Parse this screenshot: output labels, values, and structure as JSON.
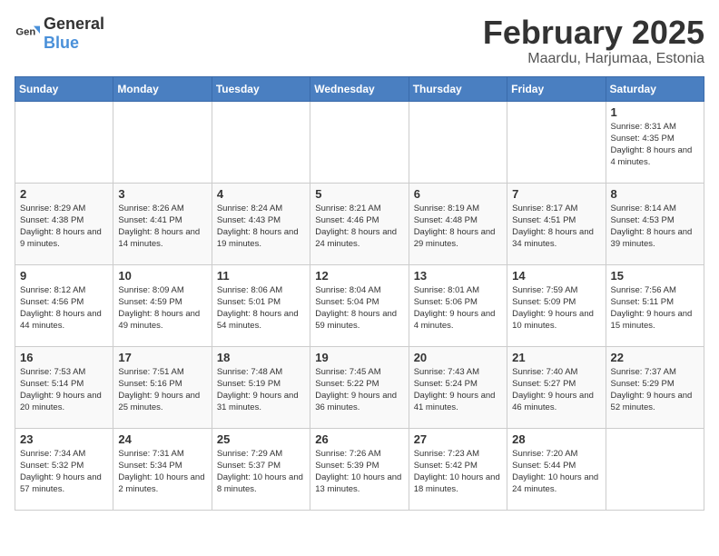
{
  "header": {
    "logo_general": "General",
    "logo_blue": "Blue",
    "main_title": "February 2025",
    "subtitle": "Maardu, Harjumaa, Estonia"
  },
  "days_of_week": [
    "Sunday",
    "Monday",
    "Tuesday",
    "Wednesday",
    "Thursday",
    "Friday",
    "Saturday"
  ],
  "weeks": [
    [
      {
        "day": "",
        "info": ""
      },
      {
        "day": "",
        "info": ""
      },
      {
        "day": "",
        "info": ""
      },
      {
        "day": "",
        "info": ""
      },
      {
        "day": "",
        "info": ""
      },
      {
        "day": "",
        "info": ""
      },
      {
        "day": "1",
        "info": "Sunrise: 8:31 AM\nSunset: 4:35 PM\nDaylight: 8 hours and 4 minutes."
      }
    ],
    [
      {
        "day": "2",
        "info": "Sunrise: 8:29 AM\nSunset: 4:38 PM\nDaylight: 8 hours and 9 minutes."
      },
      {
        "day": "3",
        "info": "Sunrise: 8:26 AM\nSunset: 4:41 PM\nDaylight: 8 hours and 14 minutes."
      },
      {
        "day": "4",
        "info": "Sunrise: 8:24 AM\nSunset: 4:43 PM\nDaylight: 8 hours and 19 minutes."
      },
      {
        "day": "5",
        "info": "Sunrise: 8:21 AM\nSunset: 4:46 PM\nDaylight: 8 hours and 24 minutes."
      },
      {
        "day": "6",
        "info": "Sunrise: 8:19 AM\nSunset: 4:48 PM\nDaylight: 8 hours and 29 minutes."
      },
      {
        "day": "7",
        "info": "Sunrise: 8:17 AM\nSunset: 4:51 PM\nDaylight: 8 hours and 34 minutes."
      },
      {
        "day": "8",
        "info": "Sunrise: 8:14 AM\nSunset: 4:53 PM\nDaylight: 8 hours and 39 minutes."
      }
    ],
    [
      {
        "day": "9",
        "info": "Sunrise: 8:12 AM\nSunset: 4:56 PM\nDaylight: 8 hours and 44 minutes."
      },
      {
        "day": "10",
        "info": "Sunrise: 8:09 AM\nSunset: 4:59 PM\nDaylight: 8 hours and 49 minutes."
      },
      {
        "day": "11",
        "info": "Sunrise: 8:06 AM\nSunset: 5:01 PM\nDaylight: 8 hours and 54 minutes."
      },
      {
        "day": "12",
        "info": "Sunrise: 8:04 AM\nSunset: 5:04 PM\nDaylight: 8 hours and 59 minutes."
      },
      {
        "day": "13",
        "info": "Sunrise: 8:01 AM\nSunset: 5:06 PM\nDaylight: 9 hours and 4 minutes."
      },
      {
        "day": "14",
        "info": "Sunrise: 7:59 AM\nSunset: 5:09 PM\nDaylight: 9 hours and 10 minutes."
      },
      {
        "day": "15",
        "info": "Sunrise: 7:56 AM\nSunset: 5:11 PM\nDaylight: 9 hours and 15 minutes."
      }
    ],
    [
      {
        "day": "16",
        "info": "Sunrise: 7:53 AM\nSunset: 5:14 PM\nDaylight: 9 hours and 20 minutes."
      },
      {
        "day": "17",
        "info": "Sunrise: 7:51 AM\nSunset: 5:16 PM\nDaylight: 9 hours and 25 minutes."
      },
      {
        "day": "18",
        "info": "Sunrise: 7:48 AM\nSunset: 5:19 PM\nDaylight: 9 hours and 31 minutes."
      },
      {
        "day": "19",
        "info": "Sunrise: 7:45 AM\nSunset: 5:22 PM\nDaylight: 9 hours and 36 minutes."
      },
      {
        "day": "20",
        "info": "Sunrise: 7:43 AM\nSunset: 5:24 PM\nDaylight: 9 hours and 41 minutes."
      },
      {
        "day": "21",
        "info": "Sunrise: 7:40 AM\nSunset: 5:27 PM\nDaylight: 9 hours and 46 minutes."
      },
      {
        "day": "22",
        "info": "Sunrise: 7:37 AM\nSunset: 5:29 PM\nDaylight: 9 hours and 52 minutes."
      }
    ],
    [
      {
        "day": "23",
        "info": "Sunrise: 7:34 AM\nSunset: 5:32 PM\nDaylight: 9 hours and 57 minutes."
      },
      {
        "day": "24",
        "info": "Sunrise: 7:31 AM\nSunset: 5:34 PM\nDaylight: 10 hours and 2 minutes."
      },
      {
        "day": "25",
        "info": "Sunrise: 7:29 AM\nSunset: 5:37 PM\nDaylight: 10 hours and 8 minutes."
      },
      {
        "day": "26",
        "info": "Sunrise: 7:26 AM\nSunset: 5:39 PM\nDaylight: 10 hours and 13 minutes."
      },
      {
        "day": "27",
        "info": "Sunrise: 7:23 AM\nSunset: 5:42 PM\nDaylight: 10 hours and 18 minutes."
      },
      {
        "day": "28",
        "info": "Sunrise: 7:20 AM\nSunset: 5:44 PM\nDaylight: 10 hours and 24 minutes."
      },
      {
        "day": "",
        "info": ""
      }
    ]
  ]
}
